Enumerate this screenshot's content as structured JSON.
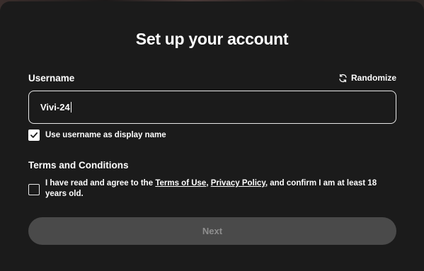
{
  "dialog": {
    "title": "Set up your account"
  },
  "username": {
    "label": "Username",
    "randomize_label": "Randomize",
    "value": "Vivi-24"
  },
  "display_name_option": {
    "label": "Use username as display name",
    "checked": true
  },
  "terms": {
    "heading": "Terms and Conditions",
    "text_before": "I have read and agree to the ",
    "terms_link": "Terms of Use",
    "separator": ", ",
    "privacy_link": "Privacy Policy",
    "text_after": ", and confirm I am at least 18 years old.",
    "checked": false
  },
  "actions": {
    "next_label": "Next",
    "next_enabled": false
  },
  "colors": {
    "modal_background": "#1b1b1b",
    "disabled_button": "#4a4a4a",
    "disabled_button_text": "#8e8e8e",
    "text": "#ffffff"
  }
}
